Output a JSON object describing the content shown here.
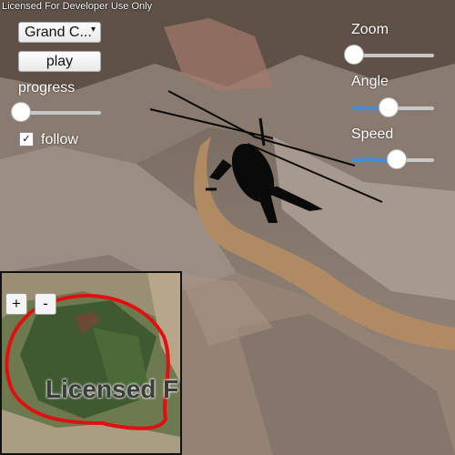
{
  "watermark": "Licensed For Developer Use Only",
  "controls": {
    "mission_selected": "Grand C...",
    "play_label": "play",
    "progress_label": "progress",
    "progress_value": 0.03,
    "follow_label": "follow",
    "follow_checked": true,
    "zoom_label": "Zoom",
    "zoom_value": 0.03,
    "angle_label": "Angle",
    "angle_value": 0.45,
    "speed_label": "Speed",
    "speed_value": 0.55
  },
  "minimap": {
    "zoom_in_label": "+",
    "zoom_out_label": "-",
    "watermark": "Licensed F",
    "route_color": "#e01010"
  },
  "colors": {
    "accent": "#3d8ee0",
    "terrain": "#8a7a6e",
    "river": "#b08a62"
  }
}
